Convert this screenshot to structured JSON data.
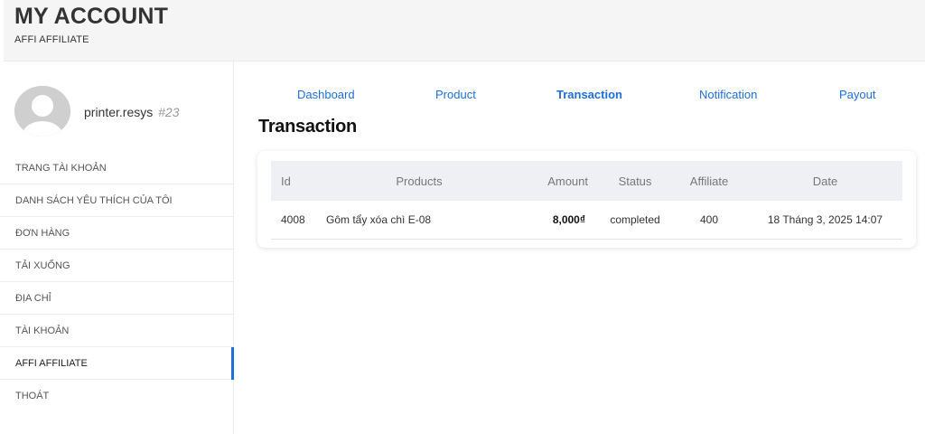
{
  "header": {
    "title": "MY ACCOUNT",
    "subtitle": "AFFI AFFILIATE"
  },
  "profile": {
    "username": "printer.resys",
    "user_id": "#23"
  },
  "sidebar": {
    "items": [
      {
        "label": "TRANG TÀI KHOẢN",
        "active": false
      },
      {
        "label": "DANH SÁCH YÊU THÍCH CỦA TÔI",
        "active": false
      },
      {
        "label": "ĐƠN HÀNG",
        "active": false
      },
      {
        "label": "TẢI XUỐNG",
        "active": false
      },
      {
        "label": "ĐỊA CHỈ",
        "active": false
      },
      {
        "label": "TÀI KHOẢN",
        "active": false
      },
      {
        "label": "AFFI AFFILIATE",
        "active": true
      },
      {
        "label": "THOÁT",
        "active": false
      }
    ]
  },
  "tabs": [
    {
      "label": "Dashboard",
      "active": false
    },
    {
      "label": "Product",
      "active": false
    },
    {
      "label": "Transaction",
      "active": true
    },
    {
      "label": "Notification",
      "active": false
    },
    {
      "label": "Payout",
      "active": false
    }
  ],
  "section_title": "Transaction",
  "table": {
    "headers": [
      "Id",
      "Products",
      "Amount",
      "Status",
      "Affiliate",
      "Date"
    ],
    "rows": [
      {
        "id": "4008",
        "product": "Gôm tẩy xóa chì E-08",
        "amount": "8,000₫",
        "status": "completed",
        "affiliate": "400",
        "date": "18 Tháng 3, 2025 14:07"
      }
    ]
  },
  "colors": {
    "accent": "#1e6fd9",
    "header_bg": "#f5f5f5",
    "table_header_bg": "#eef0f3"
  }
}
